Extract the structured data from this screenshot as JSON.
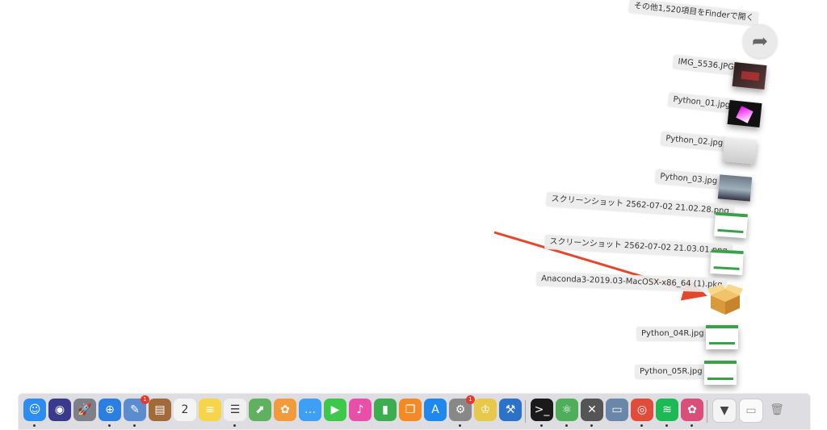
{
  "stack": {
    "more_label": "その他1,520項目をFinderで開く",
    "more_icon": "arrow-forward-icon",
    "items": [
      {
        "name": "IMG_5536.JPG"
      },
      {
        "name": "Python_01.jpg"
      },
      {
        "name": "Python_02.jpg"
      },
      {
        "name": "Python_03.jpg"
      },
      {
        "name": "スクリーンショット 2562-07-02 21.02.28.png"
      },
      {
        "name": "スクリーンショット 2562-07-02 21.03.01.png"
      },
      {
        "name": "Anaconda3-2019.03-MacOSX-x86_64 (1).pkg"
      },
      {
        "name": "Python_04R.jpg"
      },
      {
        "name": "Python_05R.jpg"
      }
    ]
  },
  "annotation": {
    "arrow_color": "#e5472c"
  },
  "dock": {
    "apps": [
      {
        "icon": "finder-icon",
        "glyph": "☺",
        "color": "#2d8cf0",
        "running": true
      },
      {
        "icon": "siri-icon",
        "glyph": "◉",
        "color": "#3a3a8c",
        "running": false
      },
      {
        "icon": "launchpad-icon",
        "glyph": "🚀",
        "color": "#7d8088",
        "running": false
      },
      {
        "icon": "safari-icon",
        "glyph": "⊕",
        "color": "#2a7fe0",
        "running": true
      },
      {
        "icon": "preview-icon",
        "glyph": "✎",
        "color": "#5b8ccf",
        "running": true,
        "badge": "1"
      },
      {
        "icon": "notebook-icon",
        "glyph": "▤",
        "color": "#a06a3a",
        "running": false
      },
      {
        "icon": "calendar-icon",
        "glyph": "2",
        "color": "#f4f4f4",
        "running": false
      },
      {
        "icon": "notes-icon",
        "glyph": "≡",
        "color": "#f6d54a",
        "running": false
      },
      {
        "icon": "reminders-icon",
        "glyph": "☰",
        "color": "#f0f0f0",
        "running": true
      },
      {
        "icon": "maps-icon",
        "glyph": "⬈",
        "color": "#5fb05f",
        "running": false
      },
      {
        "icon": "photos-icon",
        "glyph": "✿",
        "color": "#f39a3a",
        "running": false
      },
      {
        "icon": "messages-icon",
        "glyph": "…",
        "color": "#3ea0f5",
        "running": false
      },
      {
        "icon": "facetime-icon",
        "glyph": "▶",
        "color": "#3cc84a",
        "running": false
      },
      {
        "icon": "itunes-icon",
        "glyph": "♪",
        "color": "#e84fa8",
        "running": false
      },
      {
        "icon": "numbers-icon",
        "glyph": "▮",
        "color": "#3dae4f",
        "running": false
      },
      {
        "icon": "books-icon",
        "glyph": "❐",
        "color": "#f28a26",
        "running": false
      },
      {
        "icon": "app-store-icon",
        "glyph": "A",
        "color": "#1e88ee",
        "running": false
      },
      {
        "icon": "system-preferences-icon",
        "glyph": "⚙",
        "color": "#888",
        "running": true,
        "badge": "1"
      },
      {
        "icon": "sequel-icon",
        "glyph": "♔",
        "color": "#e8c84a",
        "running": false
      },
      {
        "icon": "xcode-icon",
        "glyph": "⚒",
        "color": "#2b72c8",
        "running": false
      },
      {
        "icon": "terminal-icon",
        "glyph": ">_",
        "color": "#1a1a1a",
        "running": true
      },
      {
        "icon": "atom-icon",
        "glyph": "⚛",
        "color": "#4fae5a",
        "running": true
      },
      {
        "icon": "utilities-icon",
        "glyph": "✕",
        "color": "#555",
        "running": true
      },
      {
        "icon": "scanner-icon",
        "glyph": "▭",
        "color": "#6a86a8",
        "running": false
      },
      {
        "icon": "chrome-icon",
        "glyph": "◎",
        "color": "#e04b3a",
        "running": true
      },
      {
        "icon": "spotify-icon",
        "glyph": "≋",
        "color": "#1db954",
        "running": true
      },
      {
        "icon": "anaconda-icon",
        "glyph": "✿",
        "color": "#d94f7a",
        "running": true
      }
    ],
    "downloads_icon": "downloads-stack-icon",
    "documents_icon": "documents-stack-icon",
    "trash_icon": "trash-icon"
  }
}
